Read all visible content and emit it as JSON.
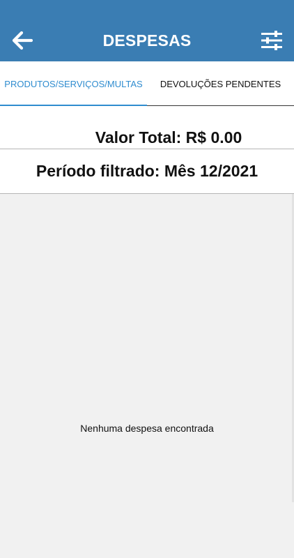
{
  "header": {
    "title": "DESPESAS",
    "back_icon": "arrow-left-icon",
    "filter_icon": "sliders-icon",
    "color": "#3a7db3"
  },
  "tabs": [
    {
      "label": "PRODUTOS/SERVIÇOS/MULTAS",
      "active": true
    },
    {
      "label": "DEVOLUÇÕES PENDENTES",
      "active": false
    }
  ],
  "summary": {
    "total": "Valor Total: R$ 0.00",
    "period": "Período filtrado: Mês 12/2021"
  },
  "empty_state": {
    "message": "Nenhuma despesa encontrada"
  },
  "colors": {
    "accent": "#2f8ccf",
    "background": "#f1f1f1"
  }
}
